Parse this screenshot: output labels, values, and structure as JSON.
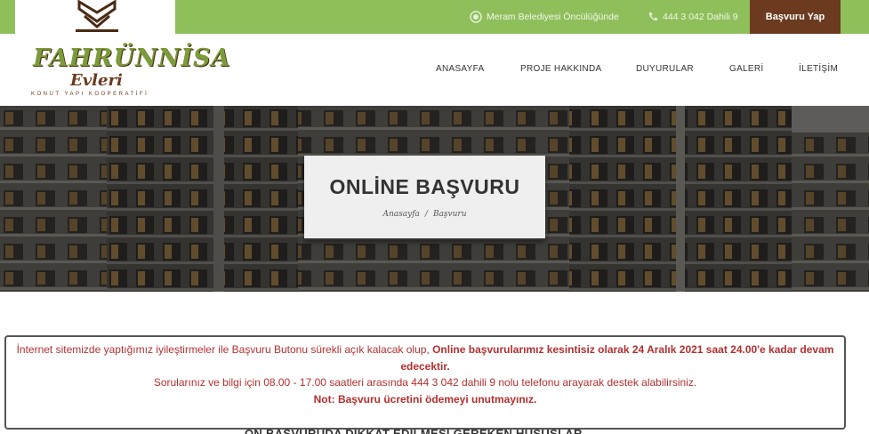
{
  "topbar": {
    "meram_text": "Meram Belediyesi Öncülüğünde",
    "phone_text": "444 3 042 Dahili 9",
    "apply_button": "Başvuru Yap",
    "icons": [
      "badge-icon",
      "phone-icon"
    ]
  },
  "logo": {
    "name": "FAHRÜNNİSA",
    "script": "Evleri",
    "subtitle": "KONUT YAPI KOOPERATİFİ"
  },
  "nav": {
    "items": [
      "ANASAYFA",
      "PROJE HAKKINDA",
      "DUYURULAR",
      "GALERİ",
      "İLETİŞİM"
    ]
  },
  "hero": {
    "title": "ONLİNE BAŞVURU",
    "breadcrumb": {
      "home": "Anasayfa",
      "separator": "/",
      "current": "Başvuru"
    }
  },
  "content": {
    "section_heading": "ON BAŞVURUDA DİKKAT EDİLMESİ GEREKEN HUSUSLAR"
  },
  "alert": {
    "line1_plain": "İnternet sitemizde yaptığımız iyileştirmeler ile Başvuru Butonu sürekli açık kalacak olup, ",
    "line1_bold": "Online başvurularımız kesintisiz olarak 24 Aralık 2021 saat 24.00'e kadar devam edecektir.",
    "line3": "Sorularınız ve bilgi için 08.00 - 17.00 saatleri arasında 444 3 042 dahili 9 nolu telefonu arayarak destek alabilirsiniz.",
    "line4": "Not: Başvuru ücretini ödemeyi unutmayınız."
  },
  "colors": {
    "topbar_green": "#8fbf5a",
    "apply_brown": "#6b3a1f",
    "alert_red": "#b33030"
  }
}
